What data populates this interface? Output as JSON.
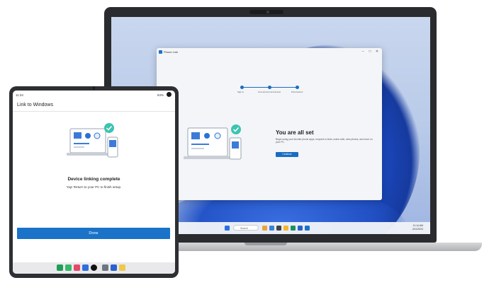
{
  "laptop": {
    "window": {
      "app_title": "Phone Link",
      "controls": {
        "minimize": "–",
        "maximize": "□",
        "close": "✕"
      },
      "steps": [
        "Sign in",
        "Link account and device",
        "Permissions"
      ],
      "heading": "You are all set",
      "description": "Begin using your favorite phone apps, respond to texts, make calls, view photos, and more on your PC.",
      "continue_label": "Continue"
    },
    "taskbar": {
      "search_placeholder": "Search",
      "tray_time": "11:14 AM",
      "tray_date": "4/11/2024"
    }
  },
  "phone": {
    "status_time": "11:34",
    "status_right": "84%",
    "title": "Link to Windows",
    "heading": "Device linking complete",
    "subtext": "Yay! Return to your PC to finish setup.",
    "done_label": "Done"
  },
  "colors": {
    "accent": "#1a73c8",
    "check": "#3cc4b0"
  }
}
